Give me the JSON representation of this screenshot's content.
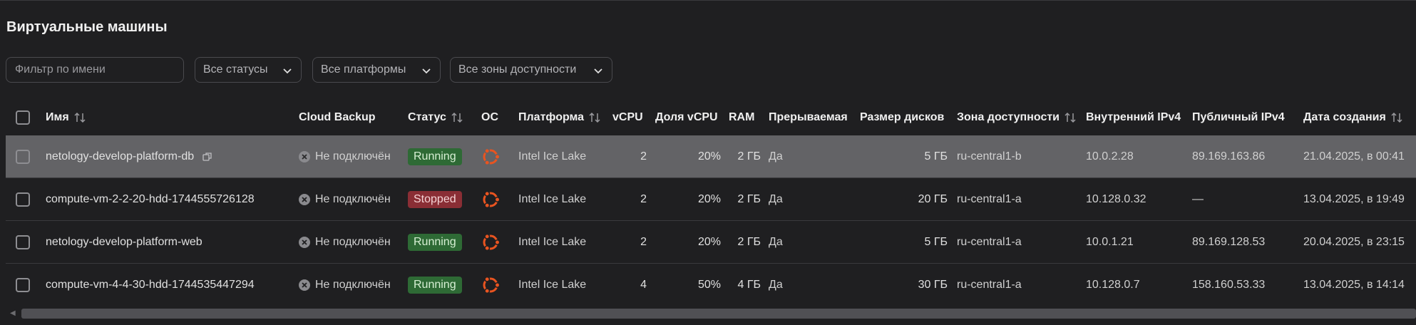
{
  "page": {
    "title": "Виртуальные машины"
  },
  "filters": {
    "name_placeholder": "Фильтр по имени",
    "status_select": "Все статусы",
    "platform_select": "Все платформы",
    "zone_select": "Все зоны доступности"
  },
  "columns": {
    "name": "Имя",
    "backup": "Cloud Backup",
    "status": "Статус",
    "os": "ОС",
    "platform": "Платформа",
    "vcpu": "vCPU",
    "vcpu_share": "Доля vCPU",
    "ram": "RAM",
    "preemptible": "Прерываемая",
    "disk": "Размер дисков",
    "zone": "Зона доступности",
    "ipv4_internal": "Внутренний IPv4",
    "ipv4_public": "Публичный IPv4",
    "created": "Дата создания"
  },
  "rows": [
    {
      "name": "netology-develop-platform-db",
      "backup": "Не подключён",
      "status": "Running",
      "platform": "Intel Ice Lake",
      "vcpu": "2",
      "vcpu_share": "20%",
      "ram": "2 ГБ",
      "preemptible": "Да",
      "disk": "5 ГБ",
      "zone": "ru-central1-b",
      "ipv4_internal": "10.0.2.28",
      "ipv4_public": "89.169.163.86",
      "created": "21.04.2025, в 00:41"
    },
    {
      "name": "compute-vm-2-2-20-hdd-1744555726128",
      "backup": "Не подключён",
      "status": "Stopped",
      "platform": "Intel Ice Lake",
      "vcpu": "2",
      "vcpu_share": "20%",
      "ram": "2 ГБ",
      "preemptible": "Да",
      "disk": "20 ГБ",
      "zone": "ru-central1-a",
      "ipv4_internal": "10.128.0.32",
      "ipv4_public": "—",
      "created": "13.04.2025, в 19:49"
    },
    {
      "name": "netology-develop-platform-web",
      "backup": "Не подключён",
      "status": "Running",
      "platform": "Intel Ice Lake",
      "vcpu": "2",
      "vcpu_share": "20%",
      "ram": "2 ГБ",
      "preemptible": "Да",
      "disk": "5 ГБ",
      "zone": "ru-central1-a",
      "ipv4_internal": "10.0.1.21",
      "ipv4_public": "89.169.128.53",
      "created": "20.04.2025, в 23:15"
    },
    {
      "name": "compute-vm-4-4-30-hdd-1744535447294",
      "backup": "Не подключён",
      "status": "Running",
      "platform": "Intel Ice Lake",
      "vcpu": "4",
      "vcpu_share": "50%",
      "ram": "4 ГБ",
      "preemptible": "Да",
      "disk": "30 ГБ",
      "zone": "ru-central1-a",
      "ipv4_internal": "10.128.0.7",
      "ipv4_public": "158.160.53.33",
      "created": "13.04.2025, в 14:14"
    }
  ],
  "icons": {
    "os": "ubuntu-icon",
    "backup": "x-circle-icon",
    "copy": "copy-icon",
    "sort": "sort-icon",
    "chevron": "chevron-down-icon"
  },
  "colors": {
    "running": "#2e6a35",
    "stopped": "#8a2e35",
    "ubuntu": "#e95420",
    "selected_row": "#636366"
  }
}
